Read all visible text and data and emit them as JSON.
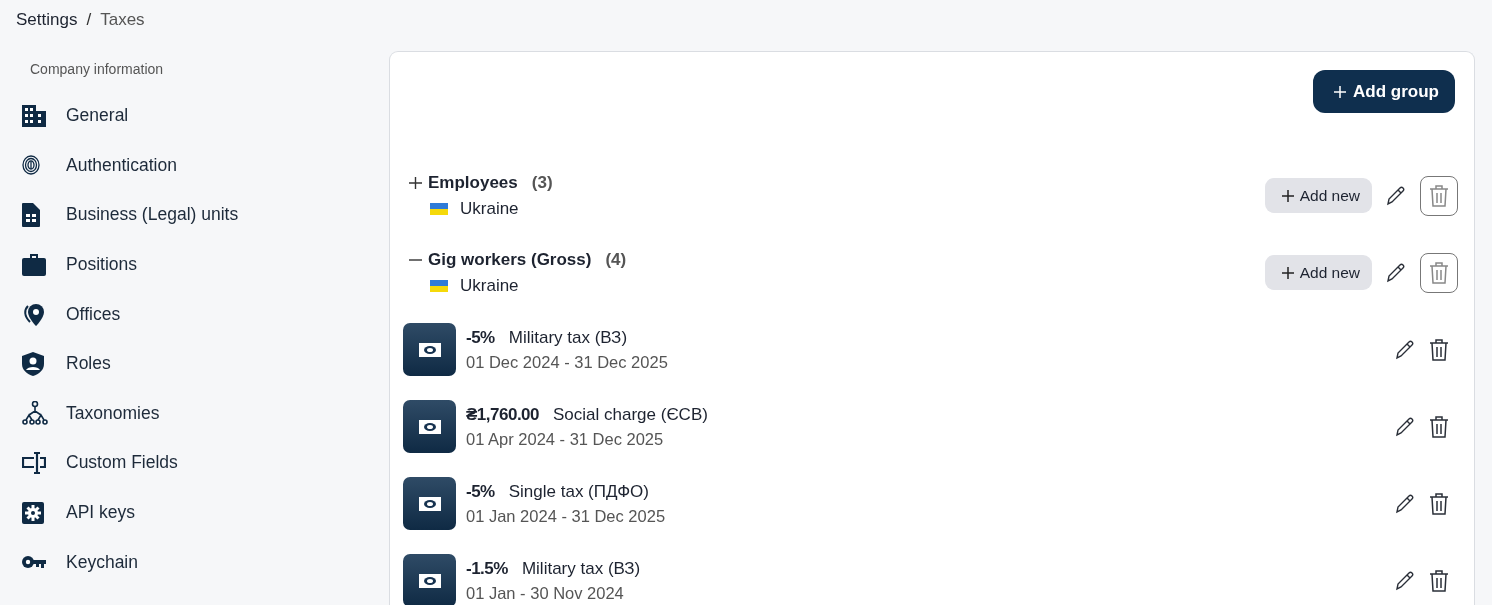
{
  "breadcrumb": {
    "items": [
      {
        "label": "Settings"
      },
      {
        "label": "Taxes"
      }
    ],
    "separator": "/"
  },
  "sidebar": {
    "section_title": "Company information",
    "items": [
      {
        "label": "General"
      },
      {
        "label": "Authentication"
      },
      {
        "label": "Business (Legal) units"
      },
      {
        "label": "Positions"
      },
      {
        "label": "Offices"
      },
      {
        "label": "Roles"
      },
      {
        "label": "Taxonomies"
      },
      {
        "label": "Custom Fields"
      },
      {
        "label": "API keys"
      },
      {
        "label": "Keychain"
      }
    ]
  },
  "panel": {
    "add_group_button": "Add group",
    "groups": [
      {
        "name": "Employees",
        "count": "(3)",
        "country": "Ukraine",
        "expanded": false,
        "add_button": "Add new"
      },
      {
        "name": "Gig workers (Gross)",
        "count": "(4)",
        "country": "Ukraine",
        "expanded": true,
        "add_button": "Add new",
        "taxes": [
          {
            "amount": "-5%",
            "name": "Military tax (ВЗ)",
            "period": "01 Dec 2024 - 31 Dec 2025"
          },
          {
            "amount": "₴1,760.00",
            "name": "Social charge (ЄСВ)",
            "period": "01 Apr 2024 - 31 Dec 2025"
          },
          {
            "amount": "-5%",
            "name": "Single tax (ПДФО)",
            "period": "01 Jan 2024 - 31 Dec 2025"
          },
          {
            "amount": "-1.5%",
            "name": "Military tax (ВЗ)",
            "period": "01 Jan - 30 Nov 2024"
          }
        ]
      }
    ]
  }
}
